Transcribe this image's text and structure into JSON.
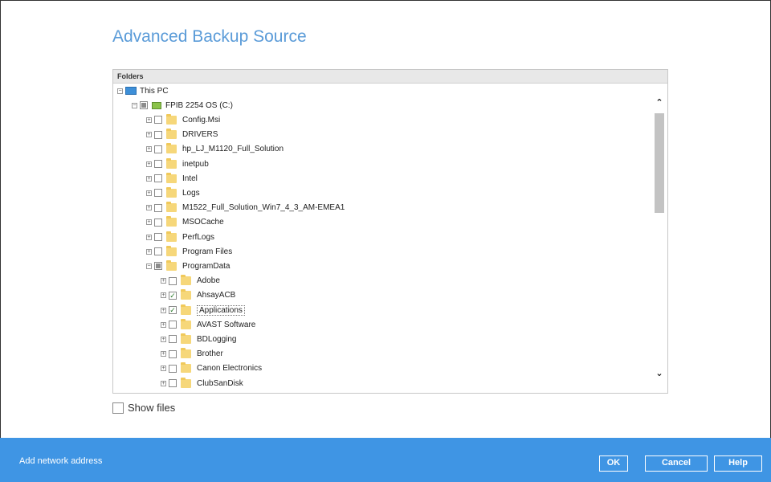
{
  "dialog": {
    "title": "Advanced Backup Source"
  },
  "tree": {
    "header": "Folders",
    "rows": [
      {
        "level": 0,
        "type": "pc",
        "label": "This PC",
        "expander": "−",
        "check": "none"
      },
      {
        "level": 1,
        "type": "drive",
        "label": "FPIB 2254 OS (C:)",
        "expander": "−",
        "check": "partial"
      },
      {
        "level": 2,
        "type": "folder",
        "label": "Config.Msi",
        "expander": "+",
        "check": "unchecked"
      },
      {
        "level": 2,
        "type": "folder",
        "label": "DRIVERS",
        "expander": "+",
        "check": "unchecked"
      },
      {
        "level": 2,
        "type": "folder",
        "label": "hp_LJ_M1120_Full_Solution",
        "expander": "+",
        "check": "unchecked"
      },
      {
        "level": 2,
        "type": "folder",
        "label": "inetpub",
        "expander": "+",
        "check": "unchecked"
      },
      {
        "level": 2,
        "type": "folder",
        "label": "Intel",
        "expander": "+",
        "check": "unchecked"
      },
      {
        "level": 2,
        "type": "folder",
        "label": "Logs",
        "expander": "+",
        "check": "unchecked"
      },
      {
        "level": 2,
        "type": "folder",
        "label": "M1522_Full_Solution_Win7_4_3_AM-EMEA1",
        "expander": "+",
        "check": "unchecked"
      },
      {
        "level": 2,
        "type": "folder",
        "label": "MSOCache",
        "expander": "+",
        "check": "unchecked"
      },
      {
        "level": 2,
        "type": "folder",
        "label": "PerfLogs",
        "expander": "+",
        "check": "unchecked"
      },
      {
        "level": 2,
        "type": "folder",
        "label": "Program Files",
        "expander": "+",
        "check": "unchecked"
      },
      {
        "level": 2,
        "type": "folder",
        "label": "ProgramData",
        "expander": "−",
        "check": "partial"
      },
      {
        "level": 3,
        "type": "folder",
        "label": "Adobe",
        "expander": "+",
        "check": "unchecked"
      },
      {
        "level": 3,
        "type": "folder",
        "label": "AhsayACB",
        "expander": "+",
        "check": "checked"
      },
      {
        "level": 3,
        "type": "folder",
        "label": "Applications",
        "expander": "+",
        "check": "checked",
        "selected": true
      },
      {
        "level": 3,
        "type": "folder",
        "label": "AVAST Software",
        "expander": "+",
        "check": "unchecked"
      },
      {
        "level": 3,
        "type": "folder",
        "label": "BDLogging",
        "expander": "+",
        "check": "unchecked"
      },
      {
        "level": 3,
        "type": "folder",
        "label": "Brother",
        "expander": "+",
        "check": "unchecked"
      },
      {
        "level": 3,
        "type": "folder",
        "label": "Canon Electronics",
        "expander": "+",
        "check": "unchecked"
      },
      {
        "level": 3,
        "type": "folder",
        "label": "ClubSanDisk",
        "expander": "+",
        "check": "unchecked"
      }
    ]
  },
  "show_files": {
    "label": "Show files",
    "checked": false
  },
  "footer": {
    "add_network_address": "Add network address",
    "ok_label": "OK",
    "cancel_label": "Cancel",
    "help_label": "Help"
  },
  "colors": {
    "footer_bg": "#3f95e4",
    "title": "#5a9bd8",
    "check_mark": "#2a7a2a"
  }
}
